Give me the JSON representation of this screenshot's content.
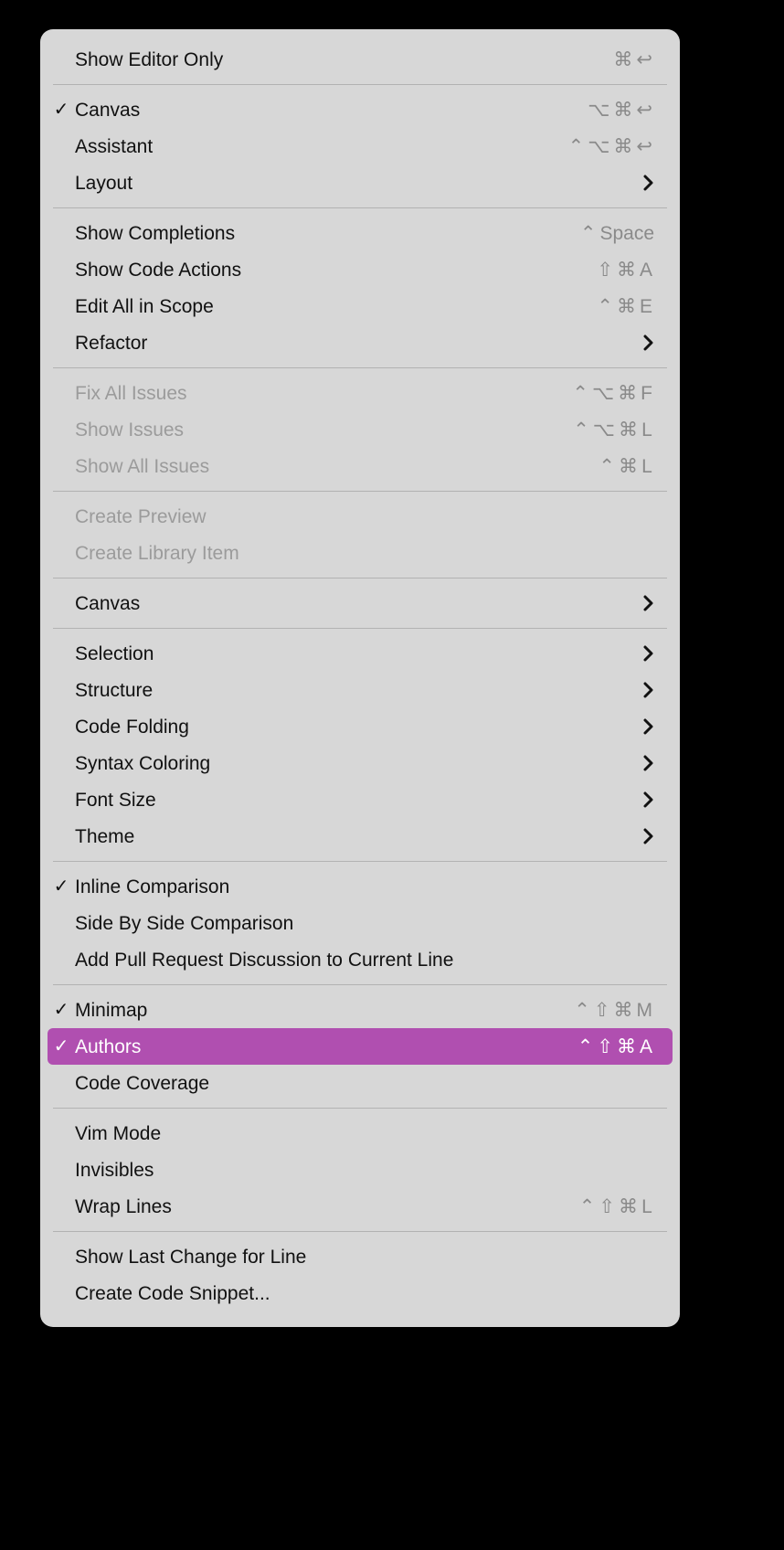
{
  "menu": {
    "groups": [
      [
        {
          "label": "Show Editor Only",
          "shortcut": "⌘ ↩",
          "checked": false,
          "submenu": false,
          "disabled": false
        }
      ],
      [
        {
          "label": "Canvas",
          "shortcut": "⌥ ⌘ ↩",
          "checked": true,
          "submenu": false,
          "disabled": false
        },
        {
          "label": "Assistant",
          "shortcut": "⌃ ⌥ ⌘ ↩",
          "checked": false,
          "submenu": false,
          "disabled": false
        },
        {
          "label": "Layout",
          "shortcut": "",
          "checked": false,
          "submenu": true,
          "disabled": false
        }
      ],
      [
        {
          "label": "Show Completions",
          "shortcut": "⌃ Space",
          "checked": false,
          "submenu": false,
          "disabled": false
        },
        {
          "label": "Show Code Actions",
          "shortcut": "⇧ ⌘ A",
          "checked": false,
          "submenu": false,
          "disabled": false
        },
        {
          "label": "Edit All in Scope",
          "shortcut": "⌃ ⌘ E",
          "checked": false,
          "submenu": false,
          "disabled": false
        },
        {
          "label": "Refactor",
          "shortcut": "",
          "checked": false,
          "submenu": true,
          "disabled": false
        }
      ],
      [
        {
          "label": "Fix All Issues",
          "shortcut": "⌃ ⌥ ⌘ F",
          "checked": false,
          "submenu": false,
          "disabled": true
        },
        {
          "label": "Show Issues",
          "shortcut": "⌃ ⌥ ⌘ L",
          "checked": false,
          "submenu": false,
          "disabled": true
        },
        {
          "label": "Show All Issues",
          "shortcut": "⌃ ⌘ L",
          "checked": false,
          "submenu": false,
          "disabled": true
        }
      ],
      [
        {
          "label": "Create Preview",
          "shortcut": "",
          "checked": false,
          "submenu": false,
          "disabled": true
        },
        {
          "label": "Create Library Item",
          "shortcut": "",
          "checked": false,
          "submenu": false,
          "disabled": true
        }
      ],
      [
        {
          "label": "Canvas",
          "shortcut": "",
          "checked": false,
          "submenu": true,
          "disabled": false
        }
      ],
      [
        {
          "label": "Selection",
          "shortcut": "",
          "checked": false,
          "submenu": true,
          "disabled": false
        },
        {
          "label": "Structure",
          "shortcut": "",
          "checked": false,
          "submenu": true,
          "disabled": false
        },
        {
          "label": "Code Folding",
          "shortcut": "",
          "checked": false,
          "submenu": true,
          "disabled": false
        },
        {
          "label": "Syntax Coloring",
          "shortcut": "",
          "checked": false,
          "submenu": true,
          "disabled": false
        },
        {
          "label": "Font Size",
          "shortcut": "",
          "checked": false,
          "submenu": true,
          "disabled": false
        },
        {
          "label": "Theme",
          "shortcut": "",
          "checked": false,
          "submenu": true,
          "disabled": false
        }
      ],
      [
        {
          "label": "Inline Comparison",
          "shortcut": "",
          "checked": true,
          "submenu": false,
          "disabled": false
        },
        {
          "label": "Side By Side Comparison",
          "shortcut": "",
          "checked": false,
          "submenu": false,
          "disabled": false
        },
        {
          "label": "Add Pull Request Discussion to Current Line",
          "shortcut": "",
          "checked": false,
          "submenu": false,
          "disabled": false
        }
      ],
      [
        {
          "label": "Minimap",
          "shortcut": "⌃ ⇧ ⌘ M",
          "checked": true,
          "submenu": false,
          "disabled": false
        },
        {
          "label": "Authors",
          "shortcut": "⌃ ⇧ ⌘ A",
          "checked": true,
          "submenu": false,
          "disabled": false,
          "selected": true
        },
        {
          "label": "Code Coverage",
          "shortcut": "",
          "checked": false,
          "submenu": false,
          "disabled": false
        }
      ],
      [
        {
          "label": "Vim Mode",
          "shortcut": "",
          "checked": false,
          "submenu": false,
          "disabled": false
        },
        {
          "label": "Invisibles",
          "shortcut": "",
          "checked": false,
          "submenu": false,
          "disabled": false
        },
        {
          "label": "Wrap Lines",
          "shortcut": "⌃ ⇧ ⌘ L",
          "checked": false,
          "submenu": false,
          "disabled": false
        }
      ],
      [
        {
          "label": "Show Last Change for Line",
          "shortcut": "",
          "checked": false,
          "submenu": false,
          "disabled": false
        },
        {
          "label": "Create Code Snippet...",
          "shortcut": "",
          "checked": false,
          "submenu": false,
          "disabled": false
        }
      ]
    ]
  }
}
